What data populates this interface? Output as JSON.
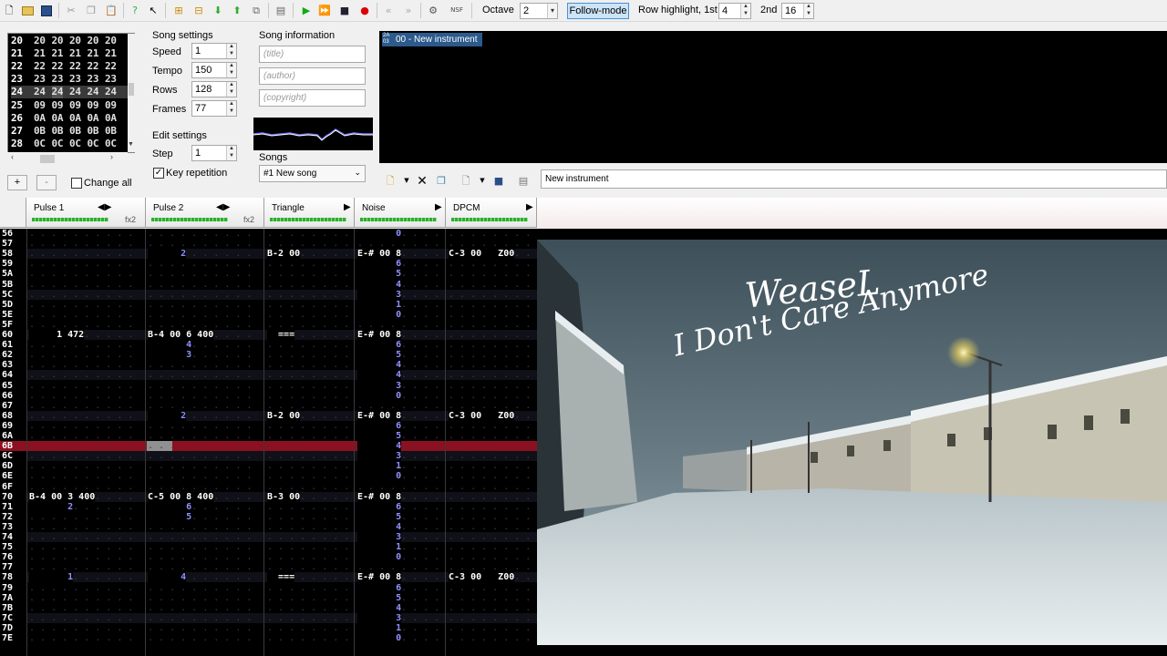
{
  "toolbar": {
    "octave_label": "Octave",
    "octave_value": "2",
    "follow_mode": "Follow-mode",
    "row_highlight_label": "Row highlight, 1st",
    "row_highlight_1st": "4",
    "second_label": "2nd",
    "row_highlight_2nd": "16",
    "nsf_label": "NSF",
    "icons": [
      "new-file-icon",
      "open-icon",
      "save-icon",
      "cut-icon",
      "copy-icon",
      "paste-icon",
      "help-icon",
      "whats-this-icon",
      "add-frame-icon",
      "insert-frame-icon",
      "move-down-icon",
      "move-up-icon",
      "duplicate-frame-icon",
      "module-properties-icon",
      "play-icon",
      "play-loop-icon",
      "stop-icon",
      "record-icon",
      "prev-song-icon",
      "next-song-icon",
      "settings-icon",
      "nsf-icon"
    ]
  },
  "frames": {
    "rows": [
      {
        "n": "20",
        "v": [
          "20",
          "20",
          "20",
          "20",
          "20"
        ]
      },
      {
        "n": "21",
        "v": [
          "21",
          "21",
          "21",
          "21",
          "21"
        ]
      },
      {
        "n": "22",
        "v": [
          "22",
          "22",
          "22",
          "22",
          "22"
        ]
      },
      {
        "n": "23",
        "v": [
          "23",
          "23",
          "23",
          "23",
          "23"
        ]
      },
      {
        "n": "24",
        "v": [
          "24",
          "24",
          "24",
          "24",
          "24"
        ]
      },
      {
        "n": "25",
        "v": [
          "09",
          "09",
          "09",
          "09",
          "09"
        ]
      },
      {
        "n": "26",
        "v": [
          "0A",
          "0A",
          "0A",
          "0A",
          "0A"
        ]
      },
      {
        "n": "27",
        "v": [
          "0B",
          "0B",
          "0B",
          "0B",
          "0B"
        ]
      },
      {
        "n": "28",
        "v": [
          "0C",
          "0C",
          "0C",
          "0C",
          "0C"
        ]
      }
    ],
    "add_label": "+",
    "remove_label": "-",
    "change_all": "Change all"
  },
  "song_settings": {
    "title": "Song settings",
    "speed_label": "Speed",
    "speed": "1",
    "tempo_label": "Tempo",
    "tempo": "150",
    "rows_label": "Rows",
    "rows": "128",
    "frames_label": "Frames",
    "frames": "77"
  },
  "edit_settings": {
    "title": "Edit settings",
    "step_label": "Step",
    "step": "1",
    "key_repetition": "Key repetition"
  },
  "song_info": {
    "title": "Song information",
    "title_placeholder": "(title)",
    "author_placeholder": "(author)",
    "copyright_placeholder": "(copyright)",
    "songs_label": "Songs",
    "song_selected": "#1 New song"
  },
  "instruments": {
    "item_badge": "2A 03",
    "item_label": "00 - New instrument",
    "name_field": "New instrument"
  },
  "channels": [
    {
      "name": "Pulse 1",
      "fx": "fx2"
    },
    {
      "name": "Pulse 2",
      "fx": "fx2"
    },
    {
      "name": "Triangle",
      "fx": ""
    },
    {
      "name": "Noise",
      "fx": ""
    },
    {
      "name": "DPCM",
      "fx": ""
    }
  ],
  "pattern": {
    "row_numbers": [
      "56",
      "57",
      "58",
      "59",
      "5A",
      "5B",
      "5C",
      "5D",
      "5E",
      "5F",
      "60",
      "61",
      "62",
      "63",
      "64",
      "65",
      "66",
      "67",
      "68",
      "69",
      "6A",
      "6B",
      "6C",
      "6D",
      "6E",
      "6F",
      "70",
      "71",
      "72",
      "73",
      "74",
      "75",
      "76",
      "77",
      "78",
      "79",
      "7A",
      "7B",
      "7C",
      "7D",
      "7E"
    ],
    "highlighted_row": "6B",
    "cells": [
      {
        "row": 0,
        "ch": 3,
        "text": "       0",
        "color": "#9090ff"
      },
      {
        "row": 2,
        "ch": 1,
        "text": "      2",
        "color": "#9090ff"
      },
      {
        "row": 2,
        "ch": 2,
        "text": "B-2 00",
        "color": "#fff"
      },
      {
        "row": 2,
        "ch": 3,
        "text": "E-# 00 8",
        "color": "#fff"
      },
      {
        "row": 2,
        "ch": 4,
        "text": "C-3 00   Z00",
        "color": "#fff"
      },
      {
        "row": 3,
        "ch": 3,
        "text": "       6",
        "color": "#9090ff"
      },
      {
        "row": 4,
        "ch": 3,
        "text": "       5",
        "color": "#9090ff"
      },
      {
        "row": 5,
        "ch": 3,
        "text": "       4",
        "color": "#9090ff"
      },
      {
        "row": 6,
        "ch": 3,
        "text": "       3",
        "color": "#9090ff"
      },
      {
        "row": 7,
        "ch": 3,
        "text": "       1",
        "color": "#9090ff"
      },
      {
        "row": 8,
        "ch": 3,
        "text": "       0",
        "color": "#9090ff"
      },
      {
        "row": 10,
        "ch": 0,
        "text": "     1 472",
        "color": "#fff"
      },
      {
        "row": 10,
        "ch": 1,
        "text": "B-4 00 6 400",
        "color": "#fff"
      },
      {
        "row": 10,
        "ch": 2,
        "text": "  ===",
        "color": "#fff"
      },
      {
        "row": 10,
        "ch": 3,
        "text": "E-# 00 8",
        "color": "#fff"
      },
      {
        "row": 11,
        "ch": 1,
        "text": "       4",
        "color": "#9090ff"
      },
      {
        "row": 11,
        "ch": 3,
        "text": "       6",
        "color": "#9090ff"
      },
      {
        "row": 12,
        "ch": 1,
        "text": "       3",
        "color": "#9090ff"
      },
      {
        "row": 12,
        "ch": 3,
        "text": "       5",
        "color": "#9090ff"
      },
      {
        "row": 13,
        "ch": 3,
        "text": "       4",
        "color": "#9090ff"
      },
      {
        "row": 14,
        "ch": 3,
        "text": "       4",
        "color": "#9090ff"
      },
      {
        "row": 15,
        "ch": 3,
        "text": "       3",
        "color": "#9090ff"
      },
      {
        "row": 16,
        "ch": 3,
        "text": "       0",
        "color": "#9090ff"
      },
      {
        "row": 18,
        "ch": 1,
        "text": "      2",
        "color": "#9090ff"
      },
      {
        "row": 18,
        "ch": 2,
        "text": "B-2 00",
        "color": "#fff"
      },
      {
        "row": 18,
        "ch": 3,
        "text": "E-# 00 8",
        "color": "#fff"
      },
      {
        "row": 18,
        "ch": 4,
        "text": "C-3 00   Z00",
        "color": "#fff"
      },
      {
        "row": 19,
        "ch": 3,
        "text": "       6",
        "color": "#9090ff"
      },
      {
        "row": 20,
        "ch": 3,
        "text": "       5",
        "color": "#9090ff"
      },
      {
        "row": 21,
        "ch": 3,
        "text": "       4",
        "color": "#9090ff"
      },
      {
        "row": 22,
        "ch": 3,
        "text": "       3",
        "color": "#9090ff"
      },
      {
        "row": 23,
        "ch": 3,
        "text": "       1",
        "color": "#9090ff"
      },
      {
        "row": 24,
        "ch": 3,
        "text": "       0",
        "color": "#9090ff"
      },
      {
        "row": 26,
        "ch": 0,
        "text": "B-4 00 3 400",
        "color": "#fff"
      },
      {
        "row": 26,
        "ch": 1,
        "text": "C-5 00 8 400",
        "color": "#fff"
      },
      {
        "row": 26,
        "ch": 2,
        "text": "B-3 00",
        "color": "#fff"
      },
      {
        "row": 26,
        "ch": 3,
        "text": "E-# 00 8",
        "color": "#fff"
      },
      {
        "row": 27,
        "ch": 0,
        "text": "       2",
        "color": "#9090ff"
      },
      {
        "row": 27,
        "ch": 1,
        "text": "       6",
        "color": "#9090ff"
      },
      {
        "row": 27,
        "ch": 3,
        "text": "       6",
        "color": "#9090ff"
      },
      {
        "row": 28,
        "ch": 1,
        "text": "       5",
        "color": "#9090ff"
      },
      {
        "row": 28,
        "ch": 3,
        "text": "       5",
        "color": "#9090ff"
      },
      {
        "row": 29,
        "ch": 3,
        "text": "       4",
        "color": "#9090ff"
      },
      {
        "row": 30,
        "ch": 3,
        "text": "       3",
        "color": "#9090ff"
      },
      {
        "row": 31,
        "ch": 3,
        "text": "       1",
        "color": "#9090ff"
      },
      {
        "row": 32,
        "ch": 3,
        "text": "       0",
        "color": "#9090ff"
      },
      {
        "row": 34,
        "ch": 0,
        "text": "       1",
        "color": "#9090ff"
      },
      {
        "row": 34,
        "ch": 1,
        "text": "      4",
        "color": "#9090ff"
      },
      {
        "row": 34,
        "ch": 2,
        "text": "  ===",
        "color": "#fff"
      },
      {
        "row": 34,
        "ch": 3,
        "text": "E-# 00 8",
        "color": "#fff"
      },
      {
        "row": 34,
        "ch": 4,
        "text": "C-3 00   Z00",
        "color": "#fff"
      },
      {
        "row": 35,
        "ch": 3,
        "text": "       6",
        "color": "#9090ff"
      },
      {
        "row": 36,
        "ch": 3,
        "text": "       5",
        "color": "#9090ff"
      },
      {
        "row": 37,
        "ch": 3,
        "text": "       4",
        "color": "#9090ff"
      },
      {
        "row": 38,
        "ch": 3,
        "text": "       3",
        "color": "#9090ff"
      },
      {
        "row": 39,
        "ch": 3,
        "text": "       1",
        "color": "#9090ff"
      },
      {
        "row": 40,
        "ch": 3,
        "text": "       0",
        "color": "#9090ff"
      }
    ]
  },
  "overlay": {
    "artist": "WeaseL",
    "song": "I Don't Care Anymore"
  }
}
